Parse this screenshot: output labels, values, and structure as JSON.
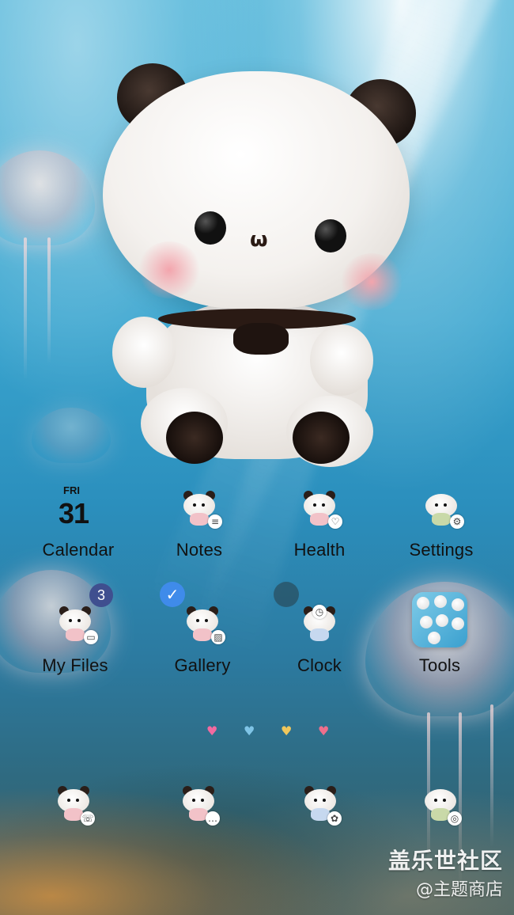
{
  "home_screen": {
    "apps_row1": [
      {
        "label": "Calendar",
        "icon": "calendar-icon",
        "cal_day": "FRI",
        "cal_date": "31"
      },
      {
        "label": "Notes",
        "icon": "notes-icon"
      },
      {
        "label": "Health",
        "icon": "health-icon"
      },
      {
        "label": "Settings",
        "icon": "settings-icon"
      }
    ],
    "apps_row2": [
      {
        "label": "My Files",
        "icon": "my-files-icon",
        "badge": "3"
      },
      {
        "label": "Gallery",
        "icon": "gallery-icon",
        "selected": "✓"
      },
      {
        "label": "Clock",
        "icon": "clock-icon"
      },
      {
        "label": "Tools",
        "icon": "tools-folder-icon"
      }
    ],
    "page_indicators": [
      {
        "icon": "heart-icon",
        "color": "#f26aa0"
      },
      {
        "icon": "heart-icon",
        "color": "#7fc4e6"
      },
      {
        "icon": "heart-icon",
        "color": "#f0c75c"
      },
      {
        "icon": "heart-icon",
        "color": "#ee6f8c"
      }
    ],
    "dock": [
      {
        "icon": "phone-icon"
      },
      {
        "icon": "messages-icon"
      },
      {
        "icon": "browser-icon"
      },
      {
        "icon": "camera-icon"
      }
    ],
    "watermark": {
      "line1": "盖乐世社区",
      "line2": "@主题商店"
    }
  }
}
